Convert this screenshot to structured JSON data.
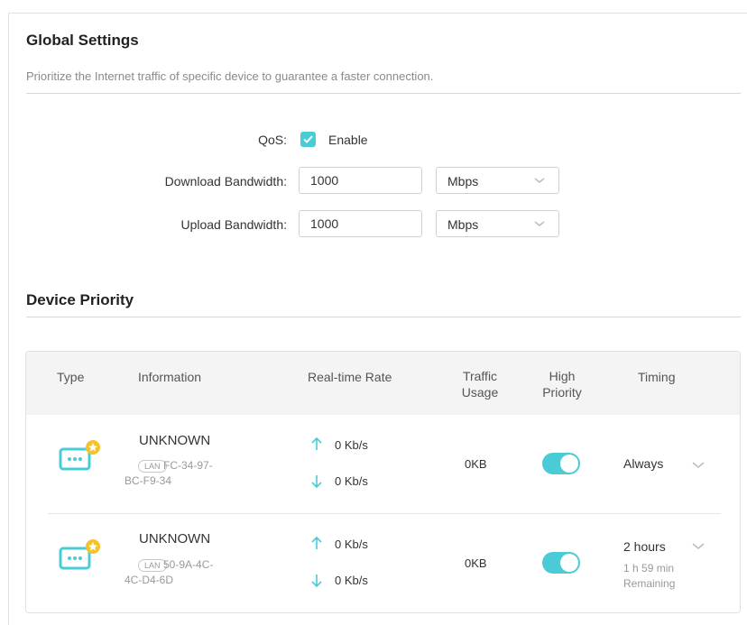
{
  "global": {
    "title": "Global Settings",
    "description": "Prioritize the Internet traffic of specific device to guarantee a faster connection.",
    "qos_label": "QoS:",
    "qos_enable_label": "Enable",
    "qos_enabled": true,
    "download_label": "Download Bandwidth:",
    "download_value": "1000",
    "download_unit": "Mbps",
    "upload_label": "Upload Bandwidth:",
    "upload_value": "1000",
    "upload_unit": "Mbps"
  },
  "device_priority": {
    "title": "Device Priority",
    "columns": {
      "type": "Type",
      "information": "Information",
      "rate": "Real-time Rate",
      "usage_line1": "Traffic",
      "usage_line2": "Usage",
      "priority_line1": "High",
      "priority_line2": "Priority",
      "timing": "Timing"
    },
    "rows": [
      {
        "name": "UNKNOWN",
        "lan_badge": "LAN",
        "mac_line1": "FC-34-97-",
        "mac_line2": "BC-F9-34",
        "up_rate": "0 Kb/s",
        "down_rate": "0 Kb/s",
        "usage": "0KB",
        "high_priority": true,
        "timing": "Always",
        "remaining_line1": "",
        "remaining_line2": ""
      },
      {
        "name": "UNKNOWN",
        "lan_badge": "LAN",
        "mac_line1": "50-9A-4C-",
        "mac_line2": "4C-D4-6D",
        "up_rate": "0 Kb/s",
        "down_rate": "0 Kb/s",
        "usage": "0KB",
        "high_priority": true,
        "timing": "2 hours",
        "remaining_line1": "1 h 59 min",
        "remaining_line2": "Remaining"
      }
    ]
  },
  "colors": {
    "accent": "#4acbd6",
    "star": "#f6c22a"
  }
}
